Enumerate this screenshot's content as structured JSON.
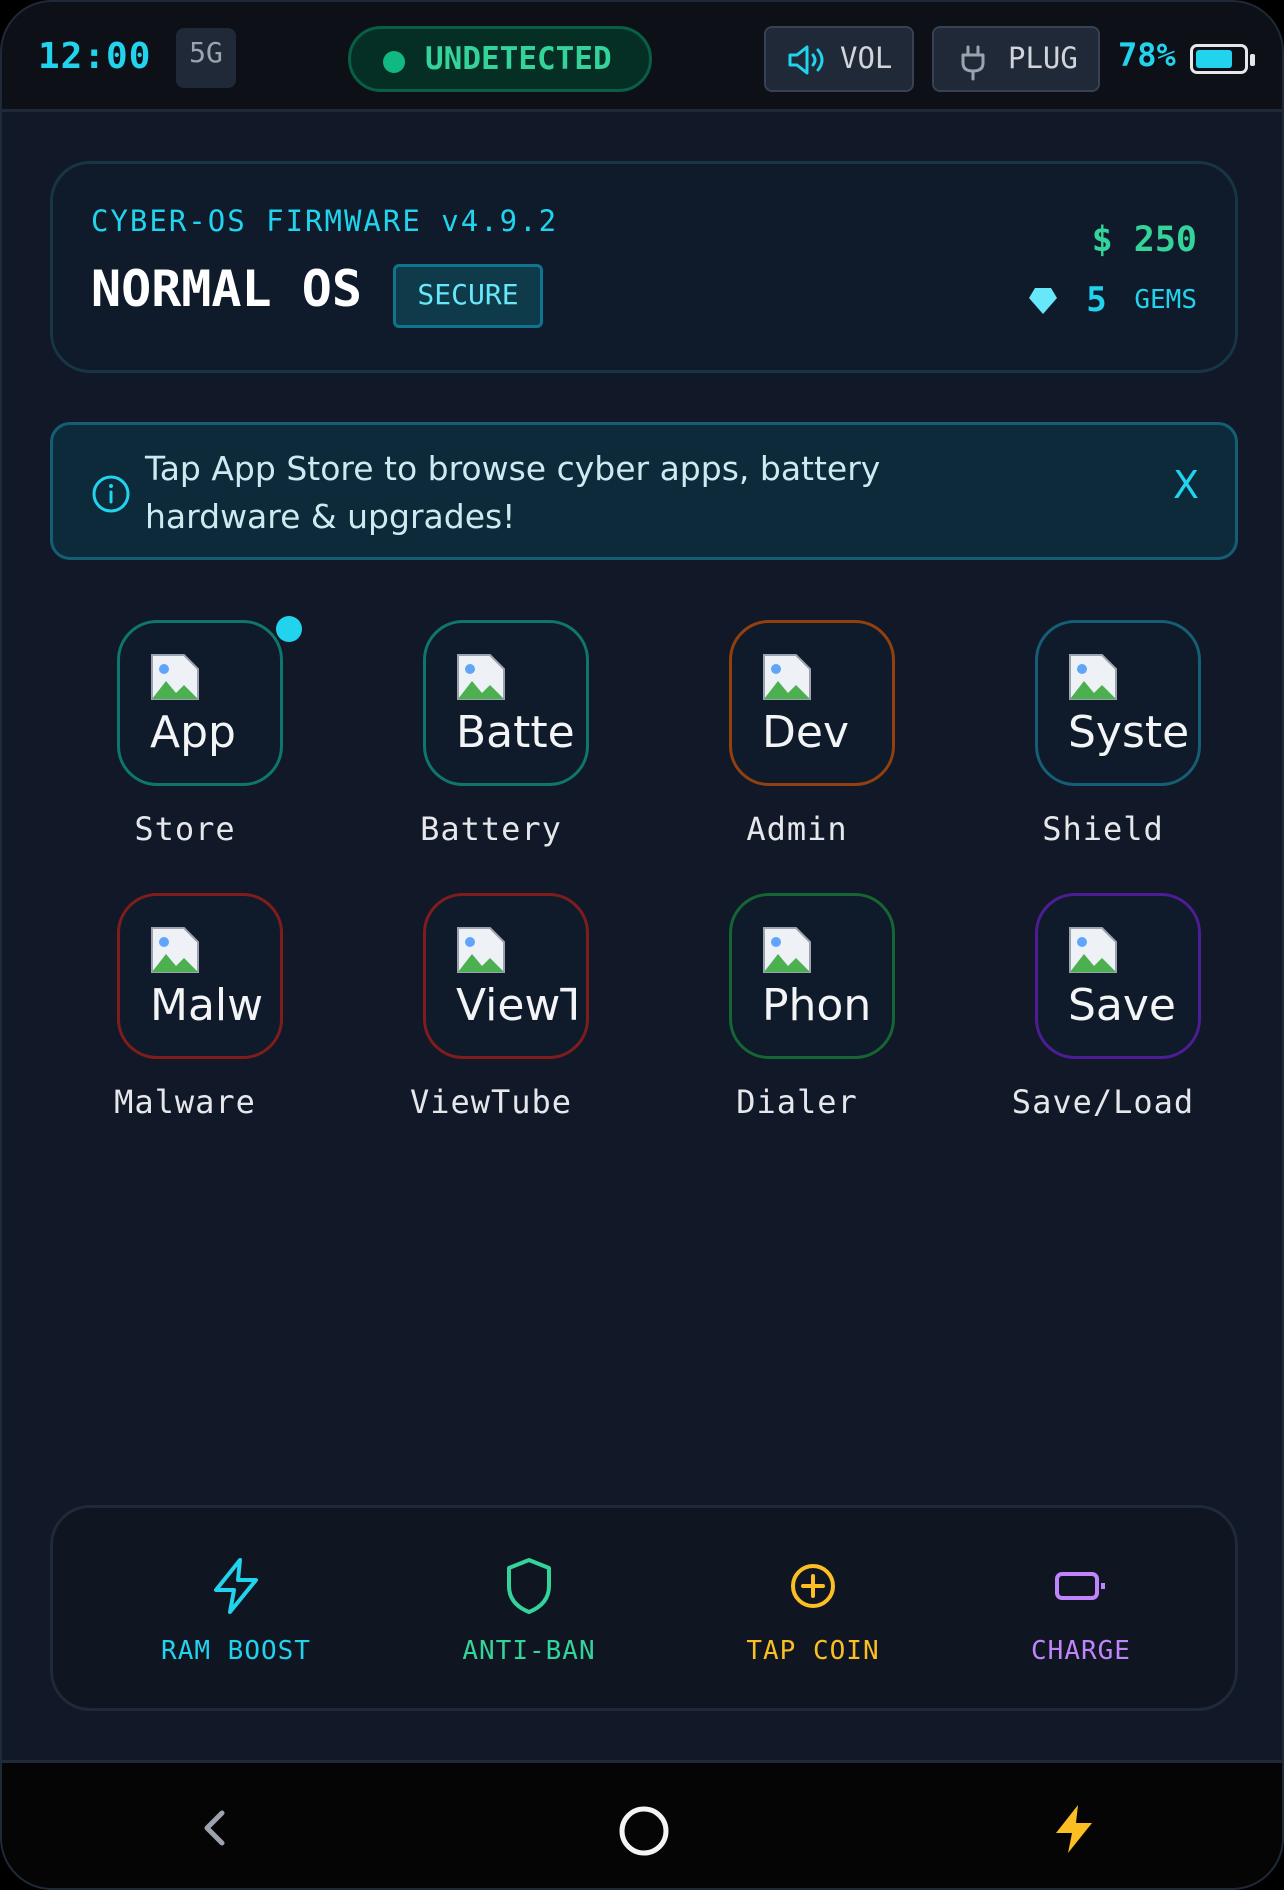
{
  "status": {
    "time": "12:00",
    "network": "5G",
    "detection": "UNDETECTED",
    "vol_label": "VOL",
    "plug_label": "PLUG",
    "battery_pct": "78%",
    "battery_level": 0.78
  },
  "header": {
    "firmware": "CYBER-OS FIRMWARE v4.9.2",
    "os_name": "NORMAL OS",
    "badge": "SECURE",
    "money": "$ 250",
    "gems_count": "5",
    "gems_label": "GEMS"
  },
  "banner": {
    "text": "Tap App Store to browse cyber apps, battery hardware & upgrades!",
    "close": "X"
  },
  "apps": [
    {
      "icon_text": "App",
      "label": "Store",
      "accent": "#0f766e"
    },
    {
      "icon_text": "Batte",
      "label": "Battery",
      "accent": "#0f766e"
    },
    {
      "icon_text": "Dev",
      "label": "Admin",
      "accent": "#92400e"
    },
    {
      "icon_text": "Syste",
      "label": "Shield",
      "accent": "#155e75"
    },
    {
      "icon_text": "Malw",
      "label": "Malware",
      "accent": "#7f1d1d"
    },
    {
      "icon_text": "ViewT",
      "label": "ViewTube",
      "accent": "#7f1d1d"
    },
    {
      "icon_text": "Phon",
      "label": "Dialer",
      "accent": "#166534"
    },
    {
      "icon_text": "Save",
      "label": "Save/Load",
      "accent": "#4c1d95"
    }
  ],
  "quick": [
    {
      "label": "RAM BOOST",
      "color": "#22d3ee",
      "icon": "lightning-icon"
    },
    {
      "label": "ANTI-BAN",
      "color": "#34d399",
      "icon": "shield-icon"
    },
    {
      "label": "TAP COIN",
      "color": "#fbbf24",
      "icon": "coin-plus-icon"
    },
    {
      "label": "CHARGE",
      "color": "#c084fc",
      "icon": "battery-icon"
    }
  ],
  "nav": {
    "back": "back-icon",
    "home": "home-icon",
    "boost": "lightning-icon"
  }
}
